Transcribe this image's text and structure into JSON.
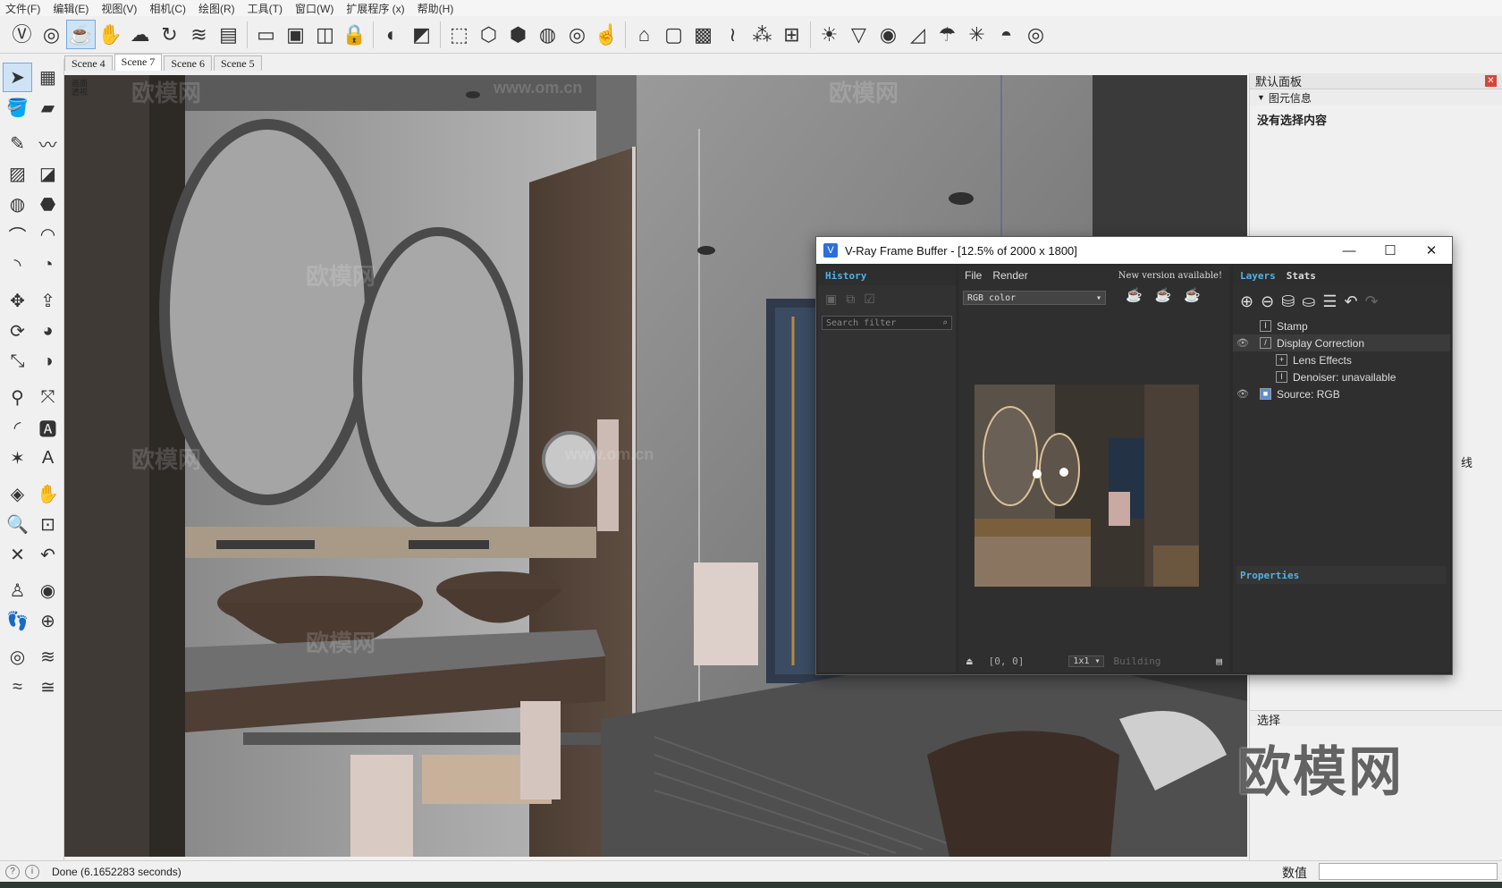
{
  "menubar": {
    "items": [
      "文件(F)",
      "编辑(E)",
      "视图(V)",
      "相机(C)",
      "绘图(R)",
      "工具(T)",
      "窗口(W)",
      "扩展程序 (x)",
      "帮助(H)"
    ]
  },
  "toolbar": {
    "icons": [
      "vray-logo-icon",
      "vray-render-icon",
      "teapot-render-icon",
      "interactive-render-icon",
      "material-editor-icon",
      "lights-icon",
      "frame-buffer-icon",
      "batch-icon",
      "sphere-icon",
      "box-icon",
      "bell-icon",
      "mesh-icon",
      "sun-icon",
      "dome-icon"
    ]
  },
  "scene_tabs": [
    "Scene 4",
    "Scene 7",
    "Scene 6",
    "Scene 5"
  ],
  "active_scene": "Scene 7",
  "viewport": {
    "corner_label_1": "画面",
    "corner_label_2": "透视",
    "watermark": "欧模网",
    "watermark_url": "www.om.cn"
  },
  "right_panel": {
    "title": "默认面板",
    "entity_info": "图元信息",
    "no_selection": "没有选择内容",
    "select_section": "选择",
    "side_label": "线"
  },
  "vfb": {
    "title": "V-Ray Frame Buffer - [12.5% of 2000 x 1800]",
    "history_tab": "History",
    "search_placeholder": "Search filter",
    "menu_file": "File",
    "menu_render": "Render",
    "new_version": "New version available!",
    "channel": "RGB color",
    "coords": "[0, 0]",
    "zoom": "1x1",
    "status": "Building",
    "layers_tab": "Layers",
    "stats_tab": "Stats",
    "layers": [
      {
        "label": "Stamp",
        "indent": 0,
        "eye": false,
        "icon": "I"
      },
      {
        "label": "Display Correction",
        "indent": 0,
        "eye": true,
        "icon": "/"
      },
      {
        "label": "Lens Effects",
        "indent": 1,
        "eye": false,
        "icon": "+"
      },
      {
        "label": "Denoiser: unavailable",
        "indent": 1,
        "eye": false,
        "icon": "I"
      },
      {
        "label": "Source: RGB",
        "indent": 0,
        "eye": true,
        "icon": "■"
      }
    ],
    "properties": "Properties"
  },
  "status_bar": {
    "message": "Done (6.1652283 seconds)",
    "measurements_label": "数值"
  },
  "brand_watermark": "欧模网"
}
